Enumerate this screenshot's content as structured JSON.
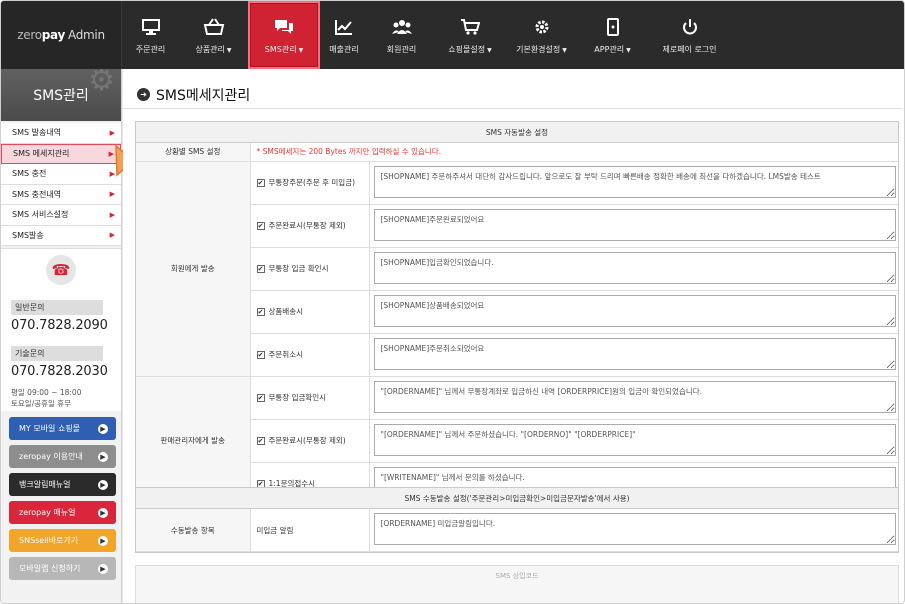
{
  "logo": {
    "brand_z": "zero",
    "brand_p": "pay",
    "admin": "Admin"
  },
  "nav": [
    {
      "label": "주문관리",
      "icon": "monitor-icon",
      "caret": ""
    },
    {
      "label": "상품관리",
      "icon": "basket-icon",
      "caret": "▼"
    },
    {
      "label": "SMS관리",
      "icon": "chat-bubbles-icon",
      "caret": "▼"
    },
    {
      "label": "매출관리",
      "icon": "line-chart-icon",
      "caret": ""
    },
    {
      "label": "회원관리",
      "icon": "users-icon",
      "caret": ""
    },
    {
      "label": "쇼핑몰설정",
      "icon": "cart-icon",
      "caret": "▼"
    },
    {
      "label": "기본환경설정",
      "icon": "gear-icon",
      "caret": "▼"
    },
    {
      "label": "APP관리",
      "icon": "mobile-icon",
      "caret": "▼"
    },
    {
      "label": "제로페이 로그인",
      "icon": "power-icon",
      "caret": ""
    }
  ],
  "sidebar": {
    "title": "SMS관리",
    "items": [
      {
        "label": "SMS 발송내역"
      },
      {
        "label": "SMS 메세지관리"
      },
      {
        "label": "SMS 충전"
      },
      {
        "label": "SMS 충전내역"
      },
      {
        "label": "SMS 서비스설정"
      },
      {
        "label": "SMS발송"
      }
    ],
    "contact": {
      "general_label": "일반문의",
      "general_number": "070.7828.2090",
      "tech_label": "기술문의",
      "tech_number": "070.7828.2030",
      "hours1": "평일 09:00 ~ 18:00",
      "hours2": "토요일/공휴일 휴무"
    },
    "buttons": [
      {
        "label": "MY 모바일 쇼핑몰",
        "color": "#2f5fb3"
      },
      {
        "label": "zeropay 이용안내",
        "color": "#8d8d8d"
      },
      {
        "label": "뱅크알림매뉴얼",
        "color": "#2b2b2b"
      },
      {
        "label": "zeropay 매뉴얼",
        "color": "#d9263a"
      },
      {
        "label": "SNSsell바로가기",
        "color": "#f2a52b"
      },
      {
        "label": "모바일앱 신청하기",
        "color": "#b7b7b7"
      }
    ]
  },
  "page": {
    "title": "SMS메세지관리"
  },
  "auto_panel": {
    "header": "SMS 자동발송 설정",
    "col_label": "상황별 SMS 설정",
    "notice": "* SMS메세지는 200 Bytes 까지만 입력하실 수 있습니다.",
    "member_label": "회원에게 발송",
    "seller_label": "판매관리자에게 발송",
    "member_rows": [
      {
        "option": "무통장주문(주문 후 미입금)",
        "text": "[SHOPNAME] 주문하주셔서 대단히 감사드립니다. 앞으로도 잘 부탁 드리며 빠른배송 정확한 배송에 최선을 다하겠습니다. LMS발송 테스트"
      },
      {
        "option": "주문완료시(무통장 제외)",
        "text": "[SHOPNAME]주문완료되었어요"
      },
      {
        "option": "무통장 입금 확인시",
        "text": "[SHOPNAME]입금확인되었습니다."
      },
      {
        "option": "상품배송시",
        "text": "[SHOPNAME]상품배송되었어요"
      },
      {
        "option": "주문취소시",
        "text": "[SHOPNAME]주문취소되었어요"
      }
    ],
    "seller_rows": [
      {
        "option": "무통장 입금확인시",
        "text": "\"[ORDERNAME]\" 님께서 무통장계좌로 입금하신 내역 [ORDERPRICE]원의 입금이 확인되었습니다."
      },
      {
        "option": "주문완료시(무통장 제외)",
        "text": "\"[ORDERNAME]\" 님께서 주문하셨습니다. \"[ORDERNO]\" \"[ORDERPRICE]\""
      },
      {
        "option": "1:1문의접수시",
        "text": "\"[WRITENAME]\" 님께서 문의를 하셨습니다."
      }
    ]
  },
  "manual_panel": {
    "header": "SMS 수동발송 설정('주문관리>미입금확인>미입금문자발송'에서 사용)",
    "label": "수동발송 항목",
    "option": "미입금 알림",
    "text": "[ORDERNAME] 미입금알림입니다."
  },
  "footer_panel": {
    "header": "SMS 상입코드"
  }
}
